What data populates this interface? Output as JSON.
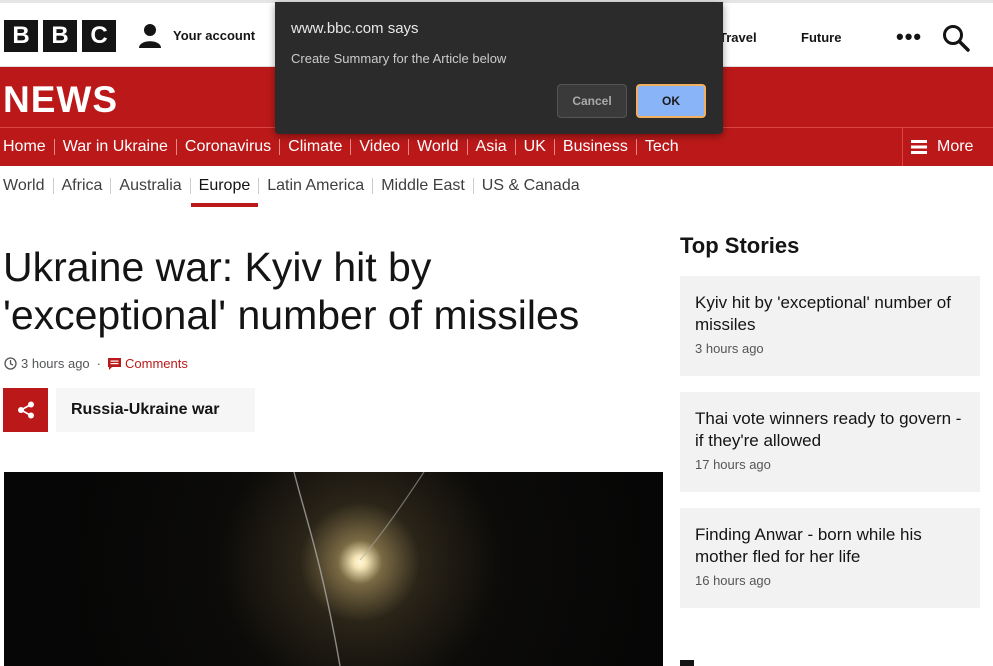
{
  "header": {
    "logo_letters": [
      "B",
      "B",
      "C"
    ],
    "account_label": "Your account",
    "nav_travel": "Travel",
    "nav_future": "Future",
    "more_dots": "•••"
  },
  "dialog": {
    "origin": "www.bbc.com says",
    "message": "Create Summary for the Article below",
    "cancel_label": "Cancel",
    "ok_label": "OK"
  },
  "news": {
    "logo": "NEWS",
    "main_nav": [
      "Home",
      "War in Ukraine",
      "Coronavirus",
      "Climate",
      "Video",
      "World",
      "Asia",
      "UK",
      "Business",
      "Tech"
    ],
    "main_nav_active": "World",
    "more_label": "More",
    "sub_nav": [
      "World",
      "Africa",
      "Australia",
      "Europe",
      "Latin America",
      "Middle East",
      "US & Canada"
    ],
    "sub_nav_active": "Europe"
  },
  "article": {
    "headline": "Ukraine war: Kyiv hit by 'exceptional' number of missiles",
    "time": "3 hours ago",
    "comments_label": "Comments",
    "tag": "Russia-Ukraine war"
  },
  "top_stories": {
    "title": "Top Stories",
    "items": [
      {
        "title": "Kyiv hit by 'exceptional' number of missiles",
        "time": "3 hours ago"
      },
      {
        "title": "Thai vote winners ready to govern - if they're allowed",
        "time": "17 hours ago"
      },
      {
        "title": "Finding Anwar - born while his mother fled for her life",
        "time": "16 hours ago"
      }
    ]
  },
  "colors": {
    "brand_red": "#bb1919",
    "dialog_bg": "#2b2b2b",
    "ok_blue": "#8ab4f8"
  }
}
